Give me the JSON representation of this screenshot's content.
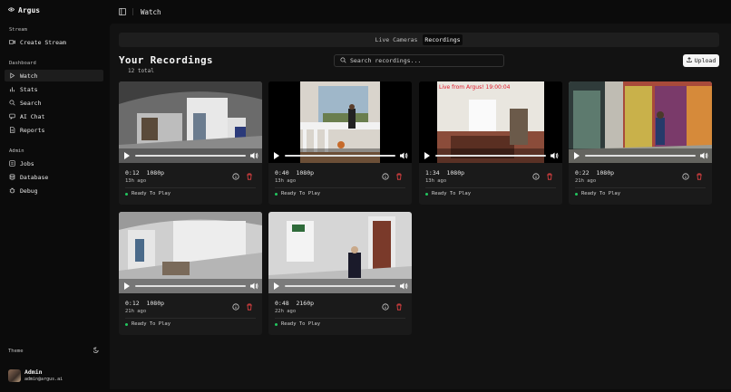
{
  "app": {
    "name": "Argus"
  },
  "sidebar": {
    "stream_label": "Stream",
    "stream_items": [
      {
        "label": "Create Stream",
        "icon": "video-plus-icon"
      }
    ],
    "dashboard_label": "Dashboard",
    "dashboard_items": [
      {
        "label": "Watch",
        "icon": "play-icon",
        "active": true
      },
      {
        "label": "Stats",
        "icon": "bar-chart-icon"
      },
      {
        "label": "Search",
        "icon": "search-icon"
      },
      {
        "label": "AI Chat",
        "icon": "chat-icon"
      },
      {
        "label": "Reports",
        "icon": "document-icon"
      }
    ],
    "admin_label": "Admin",
    "admin_items": [
      {
        "label": "Jobs",
        "icon": "list-icon"
      },
      {
        "label": "Database",
        "icon": "database-icon"
      },
      {
        "label": "Debug",
        "icon": "bug-icon"
      }
    ],
    "theme_label": "Theme",
    "user": {
      "name": "Admin",
      "email": "admin@argus.ai"
    }
  },
  "topbar": {
    "title": "Watch"
  },
  "tabs": {
    "live": "Live Cameras",
    "recordings": "Recordings"
  },
  "page": {
    "title": "Your Recordings",
    "count": "12 total",
    "search_placeholder": "Search recordings...",
    "upload_label": "Upload"
  },
  "recordings": [
    {
      "duration": "0:12",
      "resolution": "1080p",
      "age": "13h ago",
      "status": "Ready To Play"
    },
    {
      "duration": "0:40",
      "resolution": "1080p",
      "age": "13h ago",
      "status": "Ready To Play"
    },
    {
      "duration": "1:34",
      "resolution": "1080p",
      "age": "13h ago",
      "status": "Ready To Play",
      "overlay": "Live from Argus! 19:00:04"
    },
    {
      "duration": "0:22",
      "resolution": "1080p",
      "age": "21h ago",
      "status": "Ready To Play"
    },
    {
      "duration": "0:12",
      "resolution": "1080p",
      "age": "21h ago",
      "status": "Ready To Play"
    },
    {
      "duration": "0:48",
      "resolution": "2160p",
      "age": "22h ago",
      "status": "Ready To Play"
    }
  ],
  "colors": {
    "accent_green": "#22c55e",
    "trash_red": "#ef4444"
  }
}
